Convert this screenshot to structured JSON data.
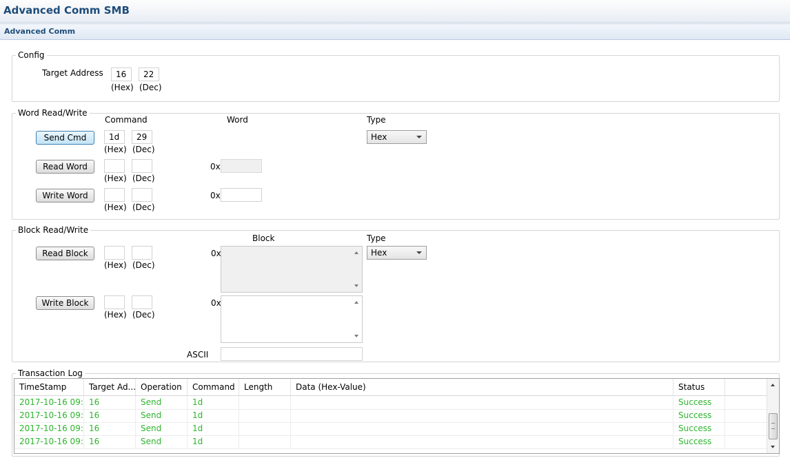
{
  "window": {
    "title": "Advanced Comm SMB"
  },
  "tab": {
    "label": "Advanced Comm"
  },
  "config": {
    "legend": "Config",
    "target_address_label": "Target Address",
    "hex_value": "16",
    "dec_value": "22",
    "hex_unit": "(Hex)",
    "dec_unit": "(Dec)"
  },
  "word": {
    "legend": "Word Read/Write",
    "command_header": "Command",
    "word_header": "Word",
    "type_header": "Type",
    "type_value": "Hex",
    "prefix": "0x",
    "hex_unit": "(Hex)",
    "dec_unit": "(Dec)",
    "send_cmd": {
      "label": "Send Cmd",
      "hex": "1d",
      "dec": "29"
    },
    "read_word": {
      "label": "Read Word",
      "hex": "",
      "dec": "",
      "value": ""
    },
    "write_word": {
      "label": "Write Word",
      "hex": "",
      "dec": "",
      "value": ""
    }
  },
  "block": {
    "legend": "Block Read/Write",
    "block_header": "Block",
    "type_header": "Type",
    "type_value": "Hex",
    "prefix": "0x",
    "hex_unit": "(Hex)",
    "dec_unit": "(Dec)",
    "ascii_label": "ASCII",
    "ascii_value": "",
    "read_block": {
      "label": "Read Block",
      "hex": "",
      "dec": ""
    },
    "write_block": {
      "label": "Write Block",
      "hex": "",
      "dec": ""
    }
  },
  "log": {
    "legend": "Transaction Log",
    "columns": [
      "TimeStamp",
      "Target Ad...",
      "Operation",
      "Command",
      "Length",
      "Data (Hex-Value)",
      "Status"
    ],
    "rows": [
      [
        "2017-10-16 09:...",
        "16",
        "Send",
        "1d",
        "",
        "",
        "Success"
      ],
      [
        "2017-10-16 09:...",
        "16",
        "Send",
        "1d",
        "",
        "",
        "Success"
      ],
      [
        "2017-10-16 09:...",
        "16",
        "Send",
        "1d",
        "",
        "",
        "Success"
      ],
      [
        "2017-10-16 09:...",
        "16",
        "Send",
        "1d",
        "",
        "",
        "Success"
      ]
    ]
  }
}
